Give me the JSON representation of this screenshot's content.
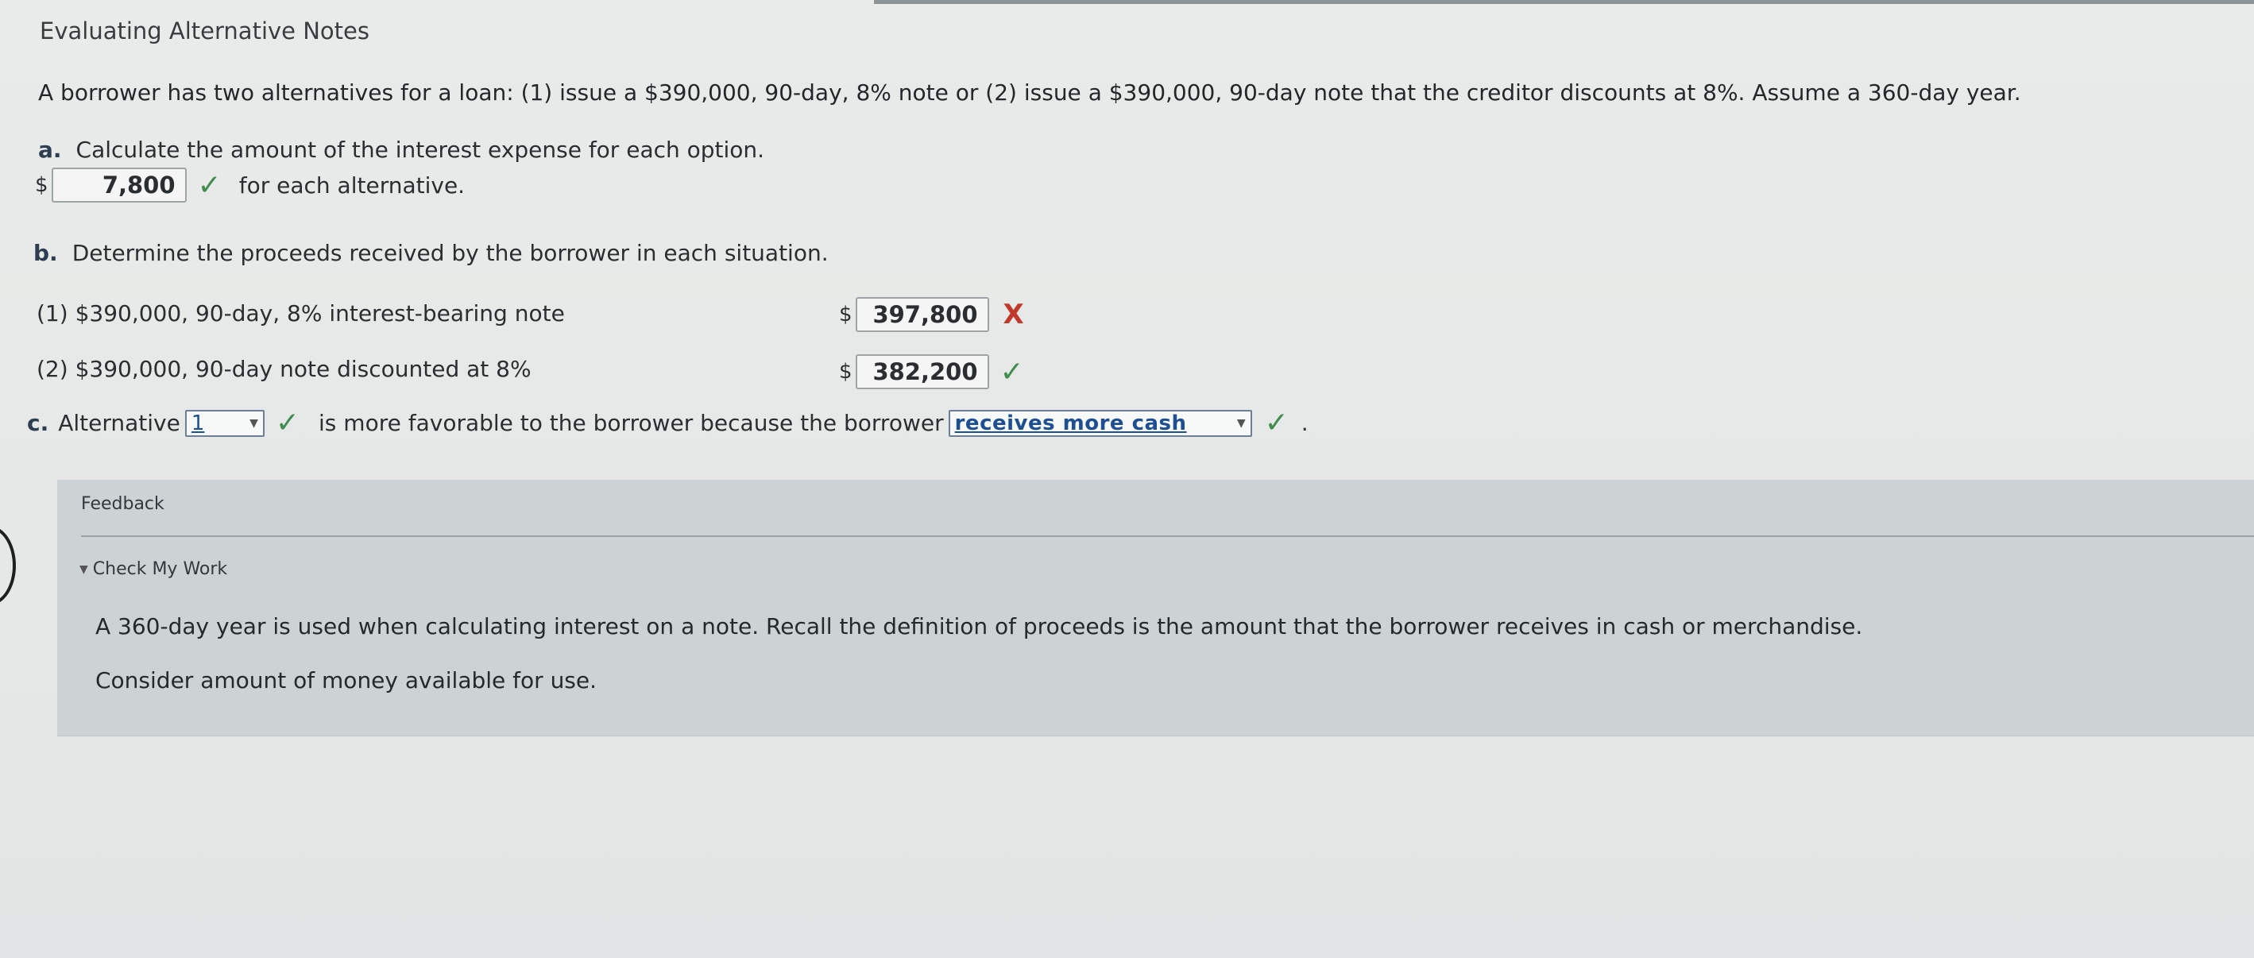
{
  "title": "Evaluating Alternative Notes",
  "intro": "A borrower has two alternatives for a loan: (1) issue a $390,000, 90-day, 8% note or (2) issue a $390,000, 90-day note that the creditor discounts at 8%. Assume a 360-day year.",
  "part_a": {
    "letter": "a.",
    "question": "Calculate the amount of the interest expense for each option.",
    "currency": "$",
    "answer": "7,800",
    "status": "correct",
    "check_symbol": "✓",
    "suffix": "for each alternative."
  },
  "part_b": {
    "letter": "b.",
    "question": "Determine the proceeds received by the borrower in each situation.",
    "rows": [
      {
        "label": "(1) $390,000, 90-day, 8% interest-bearing note",
        "currency": "$",
        "answer": "397,800",
        "status": "incorrect",
        "symbol": "X"
      },
      {
        "label": "(2) $390,000, 90-day note discounted at 8%",
        "currency": "$",
        "answer": "382,200",
        "status": "correct",
        "symbol": "✓"
      }
    ]
  },
  "part_c": {
    "letter": "c.",
    "prefix": "Alternative",
    "alternative_selected": "1",
    "middle": "is more favorable to the borrower because the borrower",
    "reason_selected": "receives more cash",
    "check_symbol": "✓",
    "period": "."
  },
  "feedback": {
    "title": "Feedback",
    "toggle": "Check My Work",
    "p1": "A 360-day year is used when calculating interest on a note. Recall the definition of proceeds is the amount that the borrower receives in cash or merchandise.",
    "p2": "Consider amount of money available for use."
  },
  "colors": {
    "correct": "#3f8d4f",
    "incorrect": "#c0392b",
    "link": "#1d4f91",
    "feedback_bg": "#cdd3d4"
  }
}
